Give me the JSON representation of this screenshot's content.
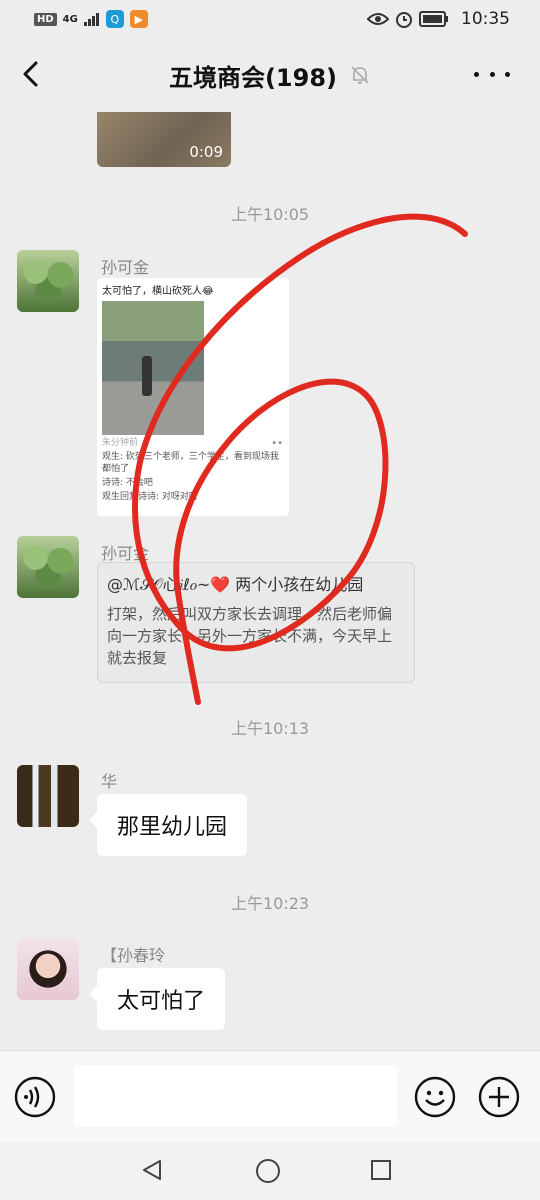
{
  "status_bar": {
    "hd": "HD",
    "network": "4G",
    "time": "10:35",
    "icons": [
      "eye-icon",
      "alarm-icon",
      "battery-icon"
    ]
  },
  "header": {
    "title": "五境商会(198)",
    "icons": [
      "back-arrow-icon",
      "mute-bell-icon",
      "more-icon"
    ]
  },
  "chat": {
    "video": {
      "duration": "0:09"
    },
    "timestamps": [
      "上午10:05",
      "上午10:13",
      "上午10:23"
    ],
    "messages": [
      {
        "sender": "孙可金",
        "type": "shared-post",
        "card": {
          "title": "太可怕了，横山砍死人😂",
          "source": "朱分钟前",
          "line1": "观生: 砍死三个老师，三个学生，看到现场我都怕了",
          "line2": "诗诗: 不会吧",
          "line3": "观生回复诗诗: 对呀对呀"
        }
      },
      {
        "sender": "孙可金",
        "type": "quote",
        "mention": "@ℳ𝒮𝒪心𝑖ℓ𝑜~❤️ 两个小孩在幼儿园",
        "text": "打架，然后叫双方家长去调理，然后老师偏向一方家长，另外一方家长不满，今天早上就去报复"
      },
      {
        "sender": "华",
        "type": "text",
        "text": "那里幼儿园"
      },
      {
        "sender": "【孙春玲",
        "type": "text",
        "text": "太可怕了"
      }
    ],
    "annotation_color": "#e02a1f"
  },
  "input_bar": {
    "placeholder": "",
    "icons": [
      "voice-icon",
      "emoji-icon",
      "plus-icon"
    ]
  },
  "nav_bar": {
    "icons": [
      "nav-back-icon",
      "nav-home-icon",
      "nav-recent-icon"
    ]
  }
}
